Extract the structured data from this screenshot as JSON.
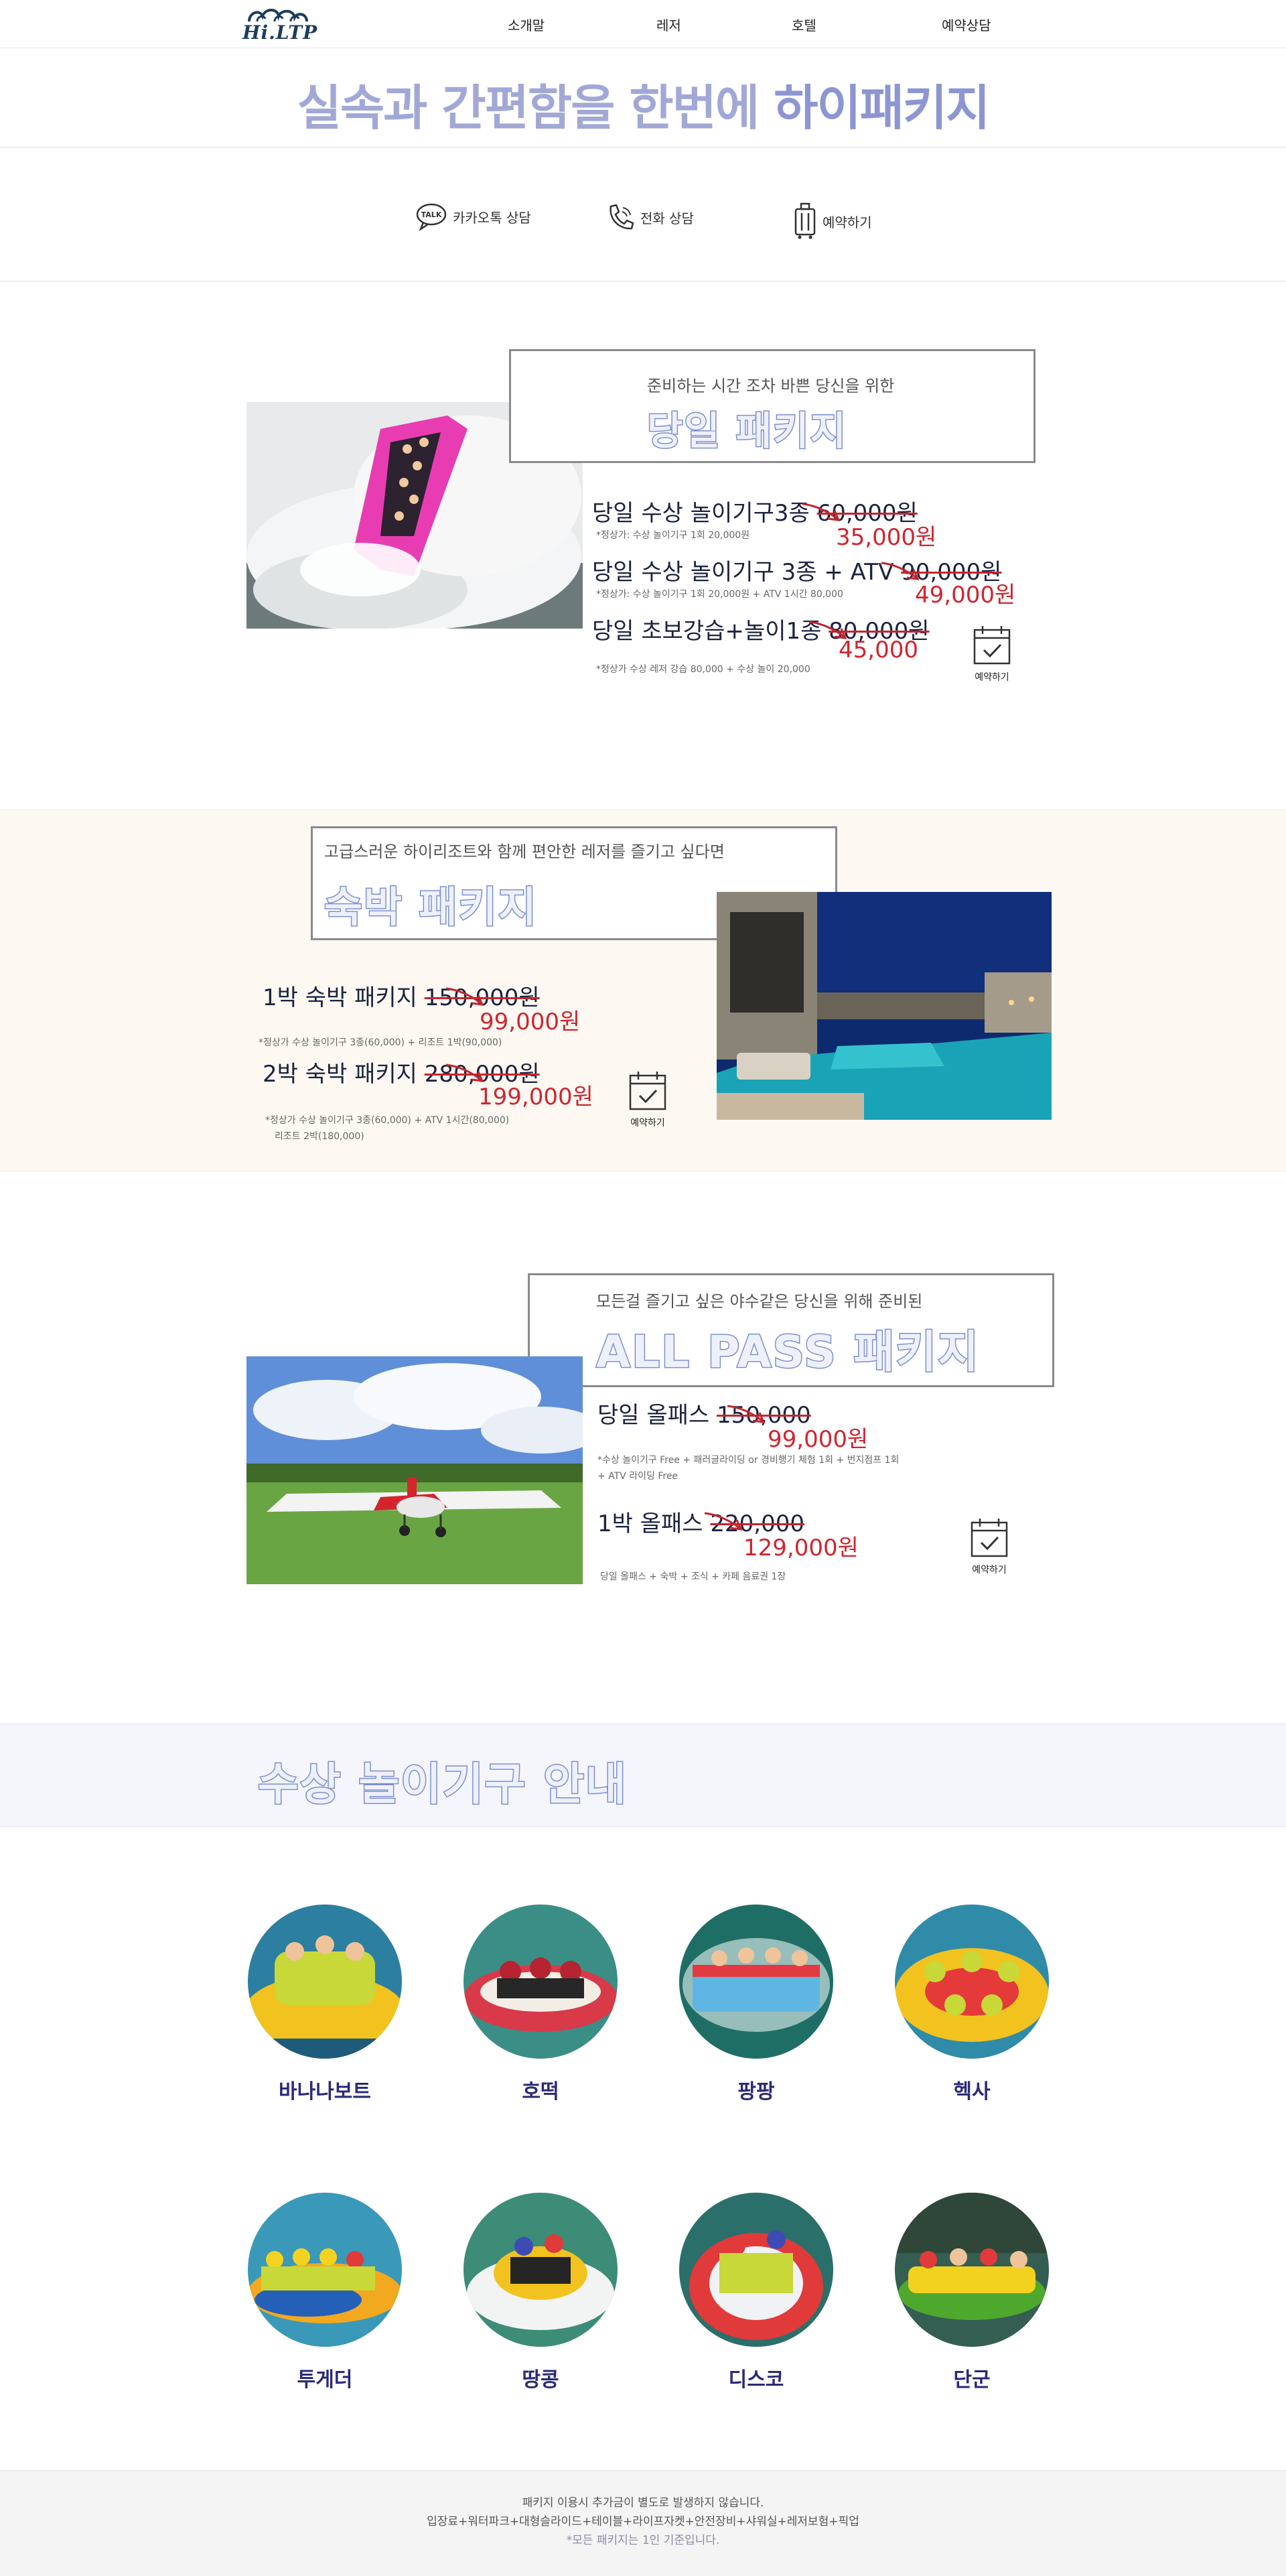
{
  "header": {
    "logo": "Hi.LTP",
    "nav": [
      "소개말",
      "레저",
      "호텔",
      "예약상담"
    ]
  },
  "slogan": {
    "normal": "실속과 간편함을 한번에 ",
    "strong": "하이패키지"
  },
  "contacts": [
    {
      "label": "카카오톡 상담",
      "icon": "kakaotalk-icon"
    },
    {
      "label": "전화 상담",
      "icon": "phone-icon"
    },
    {
      "label": "예약하기",
      "icon": "luggage-icon"
    }
  ],
  "packages": {
    "day": {
      "subtitle": "준비하는 시간 조차 바쁜 당신을 위한",
      "title": "당일 패키지",
      "items": [
        {
          "name": "당일 수상 놀이기구3종 ",
          "old": "60,000원",
          "new": "35,000원",
          "note": "*정상가: 수상 놀이기구 1회 20,000원"
        },
        {
          "name": "당일 수상 놀이기구 3종 + ATV ",
          "old": "90,000원",
          "new": "49,000원",
          "note": "*정상가: 수상 놀이기구 1회 20,000원 + ATV 1시간 80,000"
        },
        {
          "name": "당일 초보강습+놀이1종 ",
          "old": "80,000원",
          "new": "45,000",
          "note": "*정상가 수상 레저 강습 80,000 + 수상 놀이 20,000"
        }
      ],
      "reserve": "예약하기"
    },
    "stay": {
      "subtitle": "고급스러운 하이리조트와 함께 편안한 레저를 즐기고 싶다면",
      "title": "숙박 패키지",
      "items": [
        {
          "name": "1박 숙박 패키지 ",
          "old": "150,000원",
          "new": "99,000원",
          "note": "*정상가 수상 놀이기구 3종(60,000) + 리조트 1박(90,000)"
        },
        {
          "name": "2박 숙박 패키지 ",
          "old": "280,000원",
          "new": "199,000원",
          "note": "*정상가 수상 놀이기구 3종(60,000) + ATV 1시간(80,000)",
          "note2": "리조트 2박(180,000)"
        }
      ],
      "reserve": "예약하기"
    },
    "allpass": {
      "subtitle": "모든걸 즐기고 싶은 야수같은 당신을 위해 준비된",
      "title": "ALL PASS 패키지",
      "items": [
        {
          "name": "당일 올패스 ",
          "old": "150,000",
          "new": "99,000원",
          "note": "*수상 놀이기구 Free + 패러글라이딩 or 경비행기 체험  1회 + 번지점프 1회",
          "note2": "+ ATV 라이딩 Free"
        },
        {
          "name": "1박 올패스 ",
          "old": "220,000",
          "new": "129,000원",
          "note": "당일 올패스 + 숙박 + 조식 + 카페 음료권 1장"
        }
      ],
      "reserve": "예약하기"
    }
  },
  "rides": {
    "title": "수상 놀이기구 안내",
    "items": [
      "바나나보트",
      "호떡",
      "팡팡",
      "헥사",
      "투게더",
      "땅콩",
      "디스코",
      "단군"
    ]
  },
  "footer": {
    "line1": "패키지 이용시 추가금이 별도로 발생하지 않습니다.",
    "line2": "입장료+워터파크+대형슬라이드+테이블+라이프자켓+안전장비+샤워실+레저보험+픽업",
    "line3": "*모든 패키지는 1인 기준입니다."
  },
  "colors": {
    "accent": "#8d96d2",
    "price": "#d0252f",
    "navy": "#1c2340"
  }
}
